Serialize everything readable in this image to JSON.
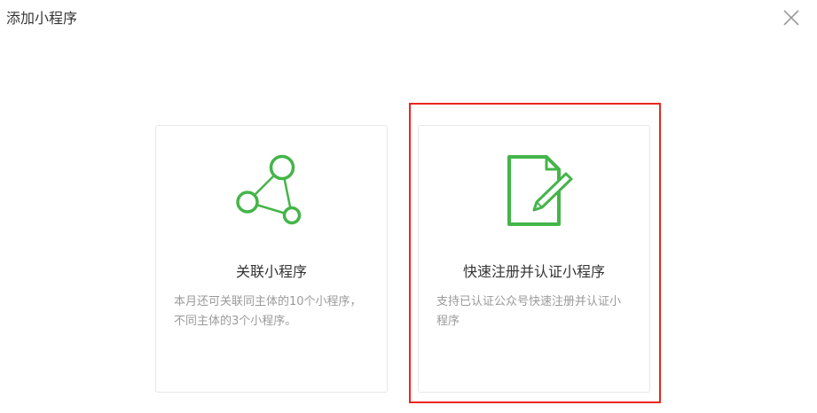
{
  "dialog": {
    "title": "添加小程序",
    "close_icon": "close-icon"
  },
  "cards": [
    {
      "icon": "network-nodes-icon",
      "title": "关联小程序",
      "description": "本月还可关联同主体的10个小程序，不同主体的3个小程序。"
    },
    {
      "icon": "document-edit-icon",
      "title": "快速注册并认证小程序",
      "description": "支持已认证公众号快速注册并认证小程序"
    }
  ],
  "colors": {
    "accent_green": "#44b549",
    "highlight_red": "#e8271f",
    "border": "#e7e7eb",
    "desc_text": "#9a9a9a"
  }
}
